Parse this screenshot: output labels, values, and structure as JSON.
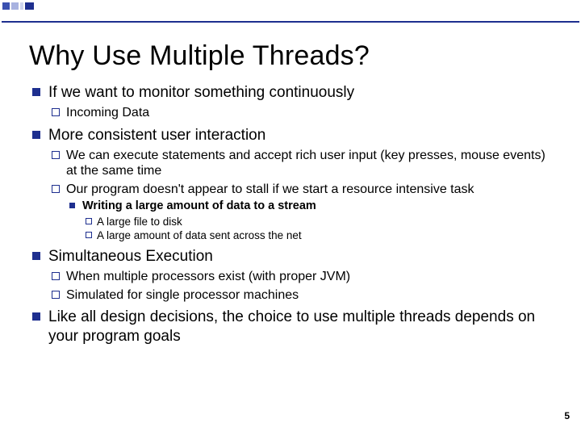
{
  "title": "Why Use Multiple Threads?",
  "b1": {
    "text": "If we want to monitor something continuously",
    "sub": {
      "s1": "Incoming Data"
    }
  },
  "b2": {
    "text": "More consistent user interaction",
    "sub": {
      "s1": "We can execute statements and accept rich user input (key presses, mouse events) at the same time",
      "s2": "Our program doesn't appear to stall if we start a resource intensive task",
      "s2sub": {
        "t1": "Writing a large amount of data to a stream",
        "t1sub": {
          "a": "A large file to disk",
          "b": "A large amount of data sent across the net"
        }
      }
    }
  },
  "b3": {
    "text": "Simultaneous Execution",
    "sub": {
      "s1": "When multiple processors exist (with proper JVM)",
      "s2": "Simulated for single processor machines"
    }
  },
  "b4": {
    "text": "Like all design decisions, the choice to use multiple threads depends on your program goals"
  },
  "page": "5"
}
